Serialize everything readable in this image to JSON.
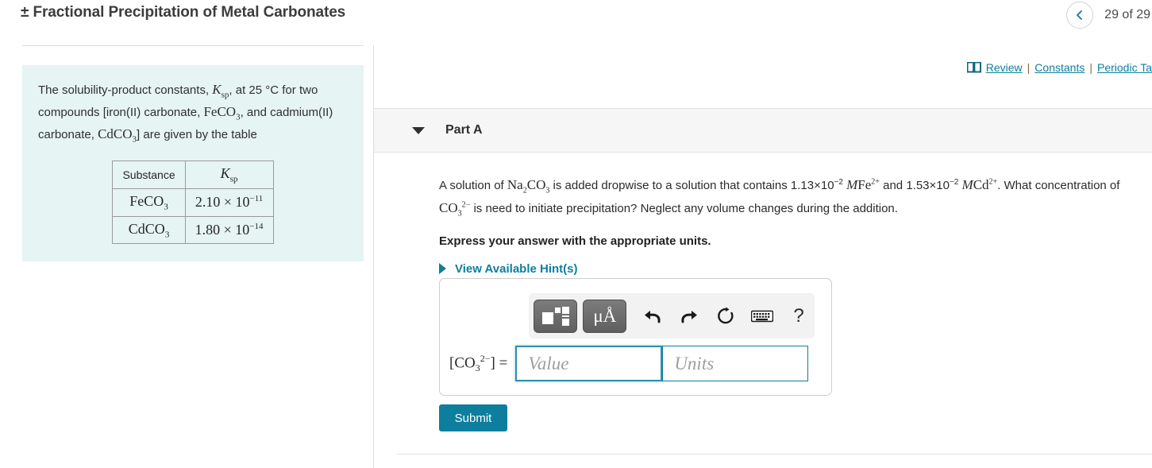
{
  "header": {
    "title": "± Fractional Precipitation of Metal Carbonates",
    "prev_icon": "chevron-left-icon",
    "page_count": "29 of 29"
  },
  "resource_links": {
    "book_icon": "book-icon",
    "review": "Review",
    "constants": "Constants",
    "periodic": "Periodic Ta",
    "separator": "|"
  },
  "problem": {
    "intro_1": "The solubility-product constants,",
    "ksp_symbol": "K",
    "ksp_sub": "sp",
    "intro_2": ", at 25 °C for two compounds [iron(II) carbonate,",
    "compound_1": "FeCO",
    "compound_1_sub": "3",
    "intro_3": ", and cadmium(II) carbonate,",
    "compound_2": "CdCO",
    "compound_2_sub": "3",
    "intro_4": "] are given by the table",
    "table": {
      "headers": [
        "Substance",
        "Ksp"
      ],
      "rows": [
        {
          "substance": "FeCO",
          "substance_sub": "3",
          "mantissa": "2.10",
          "times": "×",
          "base": "10",
          "exponent": "−11"
        },
        {
          "substance": "CdCO",
          "substance_sub": "3",
          "mantissa": "1.80",
          "times": "×",
          "base": "10",
          "exponent": "−14"
        }
      ]
    }
  },
  "part": {
    "toggle_icon": "caret-down-icon",
    "label": "Part A",
    "question_p1": "A solution of",
    "reagent": "Na",
    "reagent_sub1": "2",
    "reagent_mid": "CO",
    "reagent_sub2": "3",
    "question_p2": "is added dropwise to a solution that contains",
    "conc_fe_mantissa": "1.13×10",
    "conc_fe_exp": "−2",
    "unit_m": "M",
    "ion_fe": "Fe",
    "ion_fe_charge": "2+",
    "conjunction": "and",
    "conc_cd_mantissa": "1.53×10",
    "conc_cd_exp": "−2",
    "ion_cd": "Cd",
    "ion_cd_charge": "2+",
    "question_p3": ". What concentration of",
    "analyte": "CO",
    "analyte_sub": "3",
    "analyte_charge": "2−",
    "question_p4": "is need to initiate precipitation? Neglect any volume changes during the addition.",
    "express": "Express your answer with the appropriate units.",
    "hints_icon": "caret-right-icon",
    "hints_label": "View Available Hint(s)"
  },
  "answer": {
    "toolbar": [
      {
        "icon": "template-squares-icon",
        "label": ""
      },
      {
        "icon": "micro-angstrom-units-icon",
        "label": "μÅ"
      },
      {
        "icon": "undo-icon",
        "label": ""
      },
      {
        "icon": "redo-icon",
        "label": ""
      },
      {
        "icon": "reset-icon",
        "label": ""
      },
      {
        "icon": "keyboard-icon",
        "label": ""
      },
      {
        "icon": "help-icon",
        "label": "?"
      }
    ],
    "label_open": "[CO",
    "label_sub": "3",
    "label_charge": "2−",
    "label_close": "] =",
    "value_placeholder": "Value",
    "value_text": "",
    "units_placeholder": "Units",
    "units_text": "",
    "submit_label": "Submit"
  },
  "colors": {
    "accent_teal": "#0d7e9e",
    "panel_bg": "#e6f4f3",
    "part_header_bg": "#f6f6f6"
  }
}
